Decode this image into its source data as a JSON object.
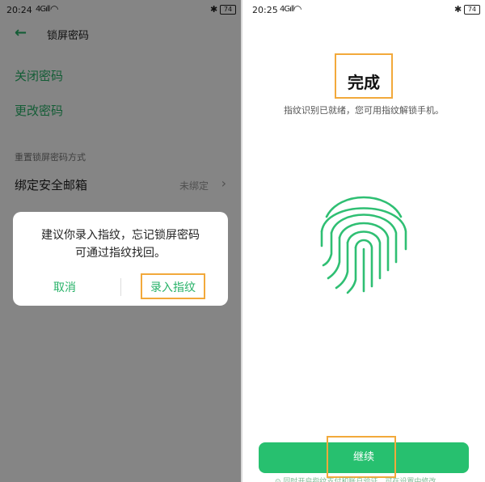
{
  "left": {
    "status": {
      "time": "20:24",
      "signal": "4Gıll",
      "battery": "74"
    },
    "header": {
      "back_icon": "back-arrow-icon",
      "title": "锁屏密码"
    },
    "menu": {
      "close_password": "关闭密码",
      "change_password": "更改密码"
    },
    "reset_section": {
      "label": "重置锁屏密码方式",
      "bind_email": {
        "title": "绑定安全邮箱",
        "value": "未绑定"
      }
    },
    "dialog": {
      "line1": "建议你录入指纹，忘记锁屏密码",
      "line2": "可通过指纹找回。",
      "cancel": "取消",
      "enroll": "录入指纹"
    }
  },
  "right": {
    "status": {
      "time": "20:25",
      "signal": "4Gıll",
      "battery": "74"
    },
    "title": "完成",
    "subtitle": "指纹识别已就绪，您可用指纹解锁手机。",
    "fingerprint_icon": "fingerprint-icon",
    "continue": "继续",
    "bottom_hint": "⊙ 同时开启指纹支付和账户验证，可在设置中修改"
  },
  "colors": {
    "accent_green": "#27c06f",
    "highlight_orange": "#f2a93b",
    "dim_overlay": "rgba(0,0,0,0.48)"
  }
}
